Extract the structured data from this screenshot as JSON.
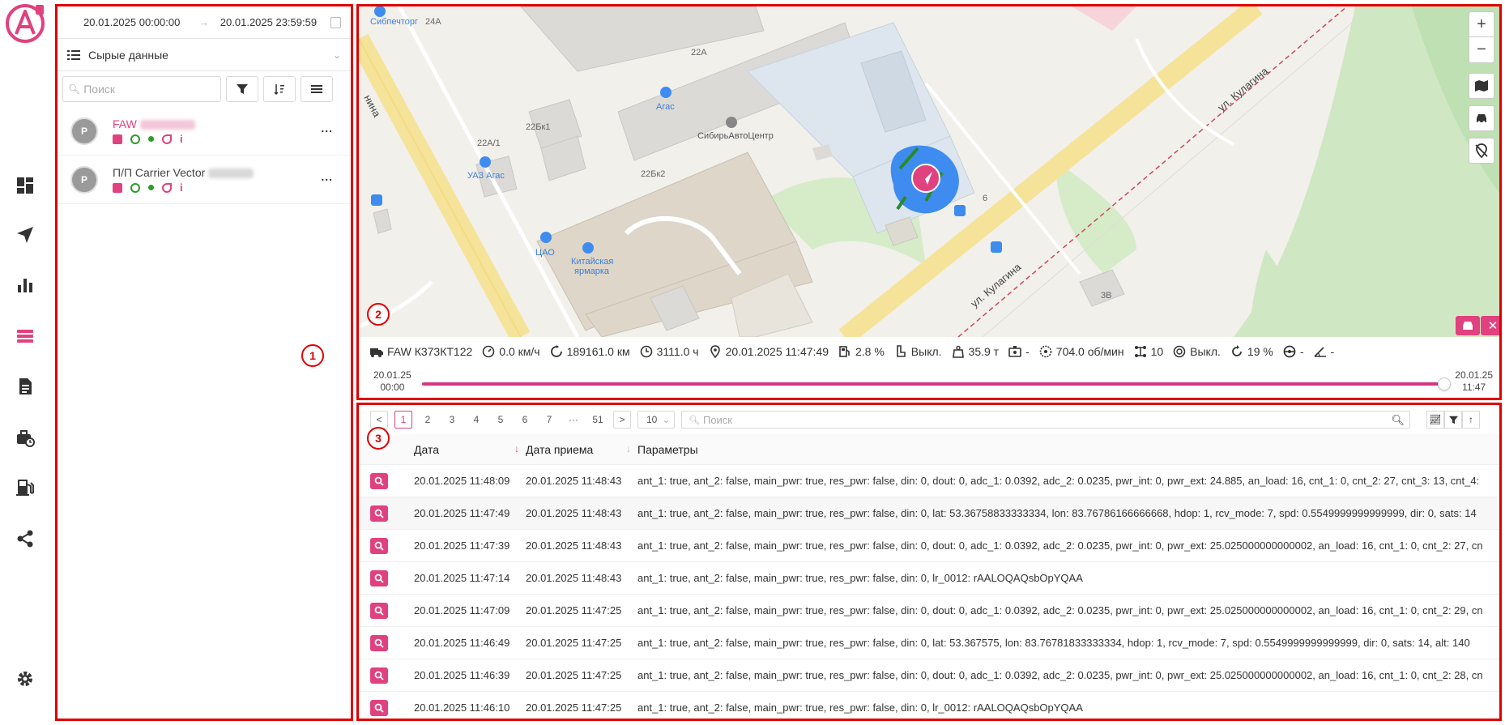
{
  "sidebar": {
    "items": [
      {
        "name": "dashboard-icon"
      },
      {
        "name": "navigation-icon"
      },
      {
        "name": "reports-chart-icon"
      },
      {
        "name": "raw-data-list-icon",
        "active": true
      },
      {
        "name": "document-icon"
      },
      {
        "name": "maintenance-icon"
      },
      {
        "name": "fuel-icon"
      },
      {
        "name": "share-icon"
      }
    ],
    "settings_icon": "gear-icon"
  },
  "left": {
    "date_from": "20.01.2025 00:00:00",
    "date_to": "20.01.2025 23:59:59",
    "mode": "Сырые данные",
    "search_placeholder": "Поиск",
    "units": [
      {
        "avatar": "P",
        "name": "FAW"
      },
      {
        "avatar": "P",
        "name": "П/П Carrier Vector"
      }
    ],
    "units_more": "...",
    "marker": "1"
  },
  "map": {
    "marker": "2",
    "zoom_in": "+",
    "zoom_out": "−",
    "labels": {
      "a24": "24А",
      "a22": "22А",
      "a22a1": "22А/1",
      "a22bk1": "22Бк1",
      "a22bk2": "22Бк2",
      "a6": "6",
      "a3v": "3В",
      "agas": "Агас",
      "uaz": "УАЗ Агас",
      "sibavto": "СибирьАвтоЦентр",
      "tsao": "ЦАО",
      "yarmarka1": "Китайская",
      "yarmarka2": "ярмарка",
      "sibpech": "Сибпечторг",
      "street1": "ул. Кулагина",
      "street2": "ул. Кулагина",
      "street3": "нина"
    }
  },
  "status": {
    "vehicle": "FAW К373КТ122",
    "speed": "0.0 км/ч",
    "odometer": "189161.0 км",
    "engine_hours": "3111.0 ч",
    "datetime": "20.01.2025 11:47:49",
    "fuel": "2.8 %",
    "seat": "Выкл.",
    "weight": "35.9 т",
    "driver": "-",
    "rpm": "704.0 об/мин",
    "axles": "10",
    "pto": "Выкл.",
    "load": "19 %",
    "wheel": "-",
    "angle": "-"
  },
  "timeline": {
    "start_date": "20.01.25",
    "start_time": "00:00",
    "end_date": "20.01.25",
    "end_time": "11:47",
    "position": 1.0
  },
  "table": {
    "marker": "3",
    "pages": [
      "1",
      "2",
      "3",
      "4",
      "5",
      "6",
      "7",
      "···",
      "51"
    ],
    "prev": "<",
    "next": ">",
    "page_size": "10",
    "search_placeholder": "Поиск",
    "headers": {
      "date": "Дата",
      "received": "Дата приема",
      "params": "Параметры"
    },
    "rows": [
      {
        "date": "20.01.2025 11:48:09",
        "received": "20.01.2025 11:48:43",
        "params": "ant_1: true, ant_2: false, main_pwr: true, res_pwr: false, din: 0, dout: 0, adc_1: 0.0392, adc_2: 0.0235, pwr_int: 0, pwr_ext: 24.885, an_load: 16, cnt_1: 0, cnt_2: 27, cnt_3: 13, cnt_4:"
      },
      {
        "date": "20.01.2025 11:47:49",
        "received": "20.01.2025 11:48:43",
        "params": "ant_1: true, ant_2: false, main_pwr: true, res_pwr: false, din: 0, lat: 53.36758833333334, lon: 83.76786166666668, hdop: 1, rcv_mode: 7, spd: 0.5549999999999999, dir: 0, sats: 14"
      },
      {
        "date": "20.01.2025 11:47:39",
        "received": "20.01.2025 11:48:43",
        "params": "ant_1: true, ant_2: false, main_pwr: true, res_pwr: false, din: 0, dout: 0, adc_1: 0.0392, adc_2: 0.0235, pwr_int: 0, pwr_ext: 25.025000000000002, an_load: 16, cnt_1: 0, cnt_2: 27, cn"
      },
      {
        "date": "20.01.2025 11:47:14",
        "received": "20.01.2025 11:48:43",
        "params": "ant_1: true, ant_2: false, main_pwr: true, res_pwr: false, din: 0, lr_0012: rAALOQAQsbOpYQAA"
      },
      {
        "date": "20.01.2025 11:47:09",
        "received": "20.01.2025 11:47:25",
        "params": "ant_1: true, ant_2: false, main_pwr: true, res_pwr: false, din: 0, dout: 0, adc_1: 0.0392, adc_2: 0.0235, pwr_int: 0, pwr_ext: 25.025000000000002, an_load: 16, cnt_1: 0, cnt_2: 29, cn"
      },
      {
        "date": "20.01.2025 11:46:49",
        "received": "20.01.2025 11:47:25",
        "params": "ant_1: true, ant_2: false, main_pwr: true, res_pwr: false, din: 0, lat: 53.367575, lon: 83.76781833333334, hdop: 1, rcv_mode: 7, spd: 0.5549999999999999, dir: 0, sats: 14, alt: 140"
      },
      {
        "date": "20.01.2025 11:46:39",
        "received": "20.01.2025 11:47:25",
        "params": "ant_1: true, ant_2: false, main_pwr: true, res_pwr: false, din: 0, dout: 0, adc_1: 0.0392, adc_2: 0.0235, pwr_int: 0, pwr_ext: 25.025000000000002, an_load: 16, cnt_1: 0, cnt_2: 28, cn"
      },
      {
        "date": "20.01.2025 11:46:10",
        "received": "20.01.2025 11:47:25",
        "params": "ant_1: true, ant_2: false, main_pwr: true, res_pwr: false, din: 0, lr_0012: rAALOQAQsbOpYQAA"
      }
    ]
  },
  "colors": {
    "accent": "#e0417f",
    "annotation": "#e00000",
    "track": "#3f8cf0"
  }
}
